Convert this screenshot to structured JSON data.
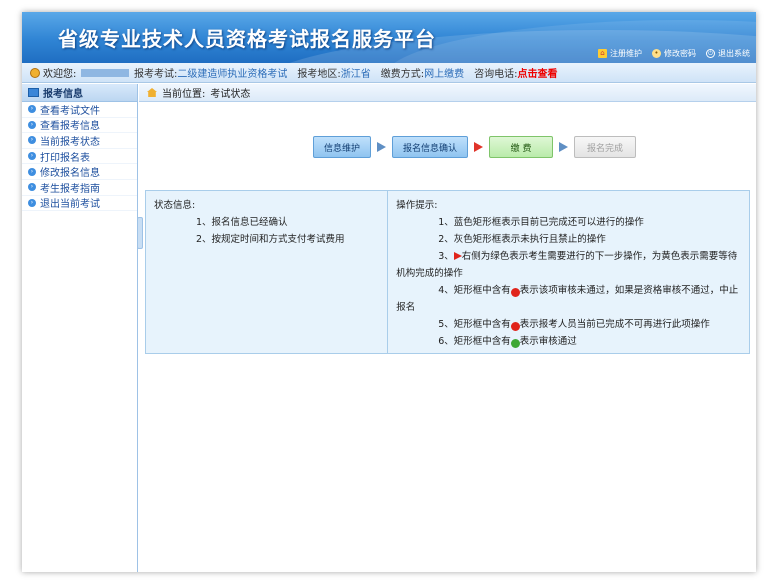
{
  "header": {
    "title": "省级专业技术人员资格考试报名服务平台",
    "links": {
      "maintain": "注册维护",
      "change_password": "修改密码",
      "logout": "退出系统"
    }
  },
  "infobar": {
    "welcome_label": "欢迎您:",
    "exam_label": "报考考试:",
    "exam_value": "二级建造师执业资格考试",
    "region_label": "报考地区:",
    "region_value": "浙江省",
    "payment_label": "缴费方式:",
    "payment_value": "网上缴费",
    "phone_label": "咨询电话:",
    "phone_link": "点击查看"
  },
  "sidebar": {
    "header": "报考信息",
    "items": [
      {
        "label": "查看考试文件"
      },
      {
        "label": "查看报考信息"
      },
      {
        "label": "当前报考状态"
      },
      {
        "label": "打印报名表"
      },
      {
        "label": "修改报名信息"
      },
      {
        "label": "考生报考指南"
      },
      {
        "label": "退出当前考试"
      }
    ]
  },
  "breadcrumb": {
    "label": "当前位置:",
    "current": "考试状态"
  },
  "steps": {
    "info_maintain": "信息维护",
    "info_confirm": "报名信息确认",
    "payment": "缴 费",
    "complete": "报名完成"
  },
  "status_panel": {
    "title": "状态信息:",
    "lines": [
      "1、报名信息已经确认",
      "2、按规定时间和方式支付考试费用"
    ]
  },
  "tips_panel": {
    "title": "操作提示:",
    "tip1": "1、蓝色矩形框表示目前已完成还可以进行的操作",
    "tip2": "2、灰色矩形框表示未执行且禁止的操作",
    "tip3_prefix": "3、",
    "tip3_text": "右侧为绿色表示考生需要进行的下一步操作，为黄色表示需要等待机构完成的操作",
    "tip4_prefix": "4、矩形框中含有",
    "tip4_text": "表示该项审核未通过，如果是资格审核不通过，中止报名",
    "tip5_prefix": "5、矩形框中含有",
    "tip5_text": "表示报考人员当前已完成不可再进行此项操作",
    "tip6_prefix": "6、矩形框中含有",
    "tip6_text": "表示审核通过"
  },
  "colors": {
    "banner": "#2f84d4",
    "sidebar_link": "#1d4f9e",
    "step_blue": "#8fc4f0",
    "step_green": "#b9ebaa",
    "step_gray": "#e4e4e4",
    "alert_red": "#e00000"
  }
}
